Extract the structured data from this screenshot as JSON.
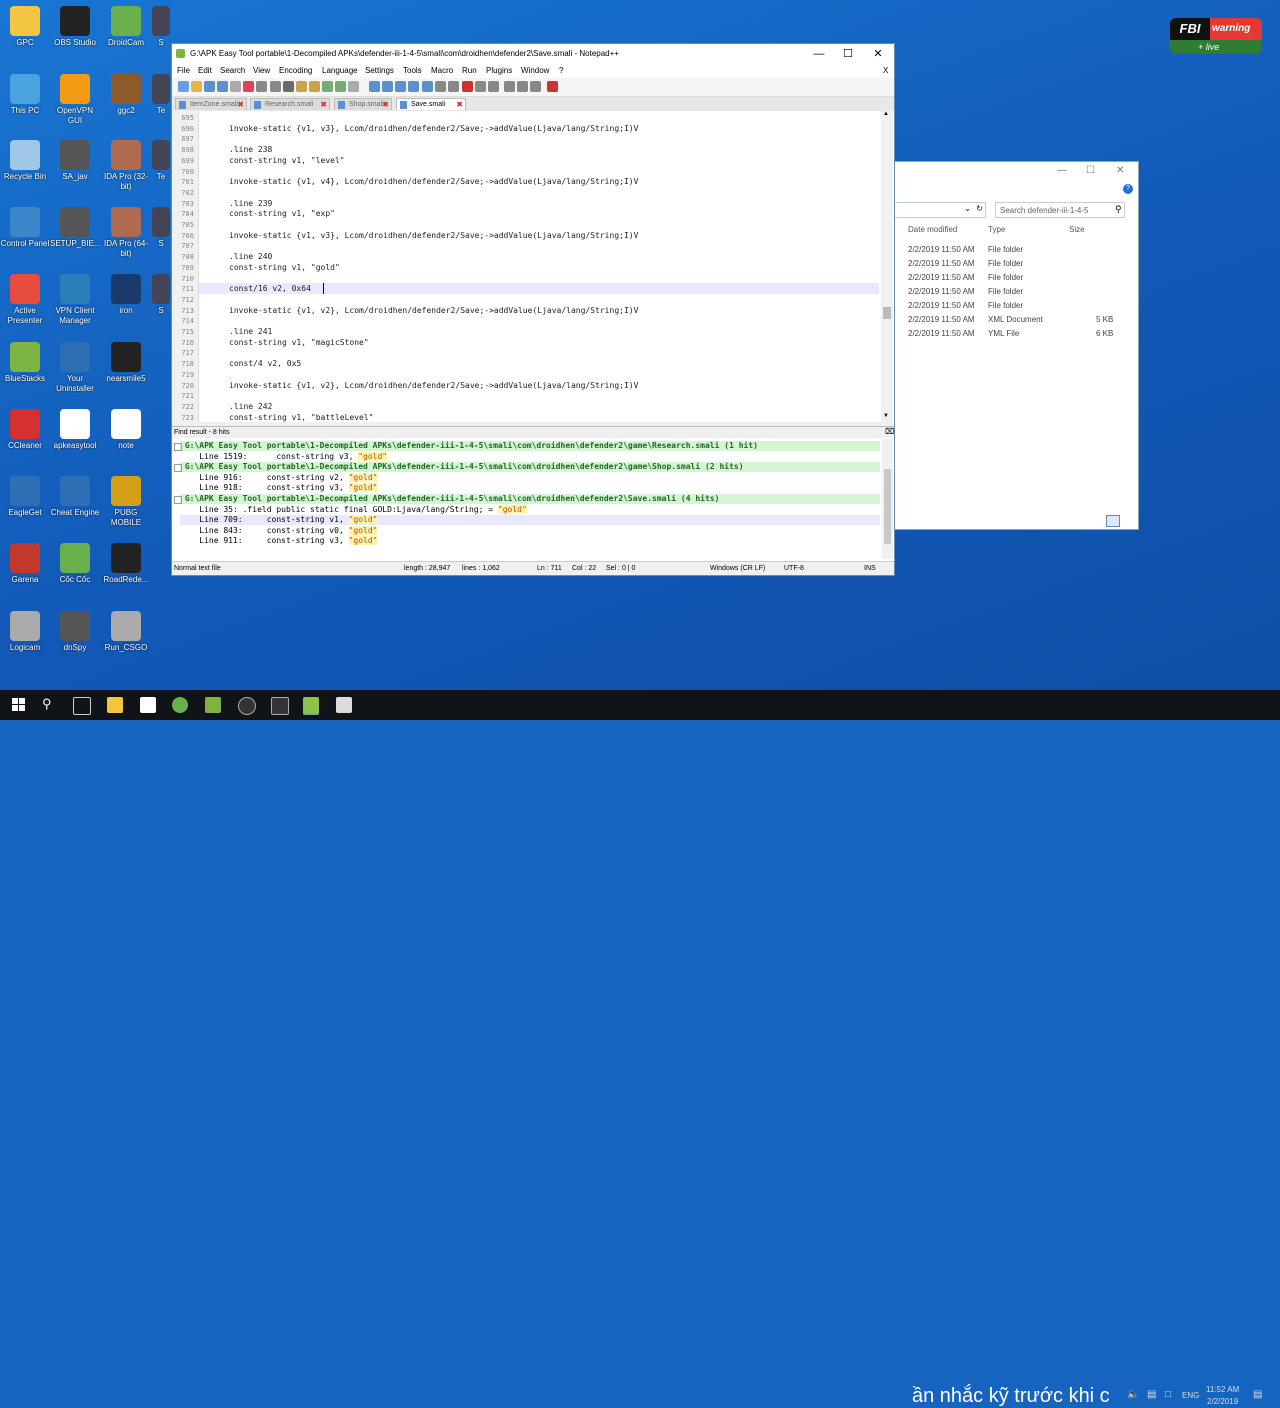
{
  "desktop_icons": [
    {
      "label": "GPC",
      "color": "#f4c542"
    },
    {
      "label": "OBS Studio",
      "color": "#222"
    },
    {
      "label": "DroidCam",
      "color": "#6ab04c"
    },
    {
      "label": "This PC",
      "color": "#4aa3df"
    },
    {
      "label": "OpenVPN GUI",
      "color": "#f39c12"
    },
    {
      "label": "ggc2",
      "color": "#8e5a2a"
    },
    {
      "label": "Recycle Bin",
      "color": "#9fc7e8"
    },
    {
      "label": "SA_jav",
      "color": "#555"
    },
    {
      "label": "IDA Pro (32-bit)",
      "color": "#b06a50"
    },
    {
      "label": "Control Panel",
      "color": "#3a86c8"
    },
    {
      "label": "SETUP_BIE...",
      "color": "#555"
    },
    {
      "label": "IDA Pro (64-bit)",
      "color": "#b06a50"
    },
    {
      "label": "Active Presenter",
      "color": "#e74c3c"
    },
    {
      "label": "VPN Client Manager",
      "color": "#2980b9"
    },
    {
      "label": "iron",
      "color": "#1a3a6a"
    },
    {
      "label": "BlueStacks",
      "color": "#7cb342"
    },
    {
      "label": "Your Uninstaller",
      "color": "#2c6fb5"
    },
    {
      "label": "nearsmile5",
      "color": "#222"
    },
    {
      "label": "CCleaner",
      "color": "#d63031"
    },
    {
      "label": "apkeasytool",
      "color": "#fff"
    },
    {
      "label": "note",
      "color": "#fff"
    },
    {
      "label": "EagleGet",
      "color": "#2c6fb5"
    },
    {
      "label": "Cheat Engine",
      "color": "#2c6fb5"
    },
    {
      "label": "PUBG MOBILE",
      "color": "#d4a017"
    },
    {
      "label": "Garena",
      "color": "#c0392b"
    },
    {
      "label": "Cốc Cốc",
      "color": "#6ab04c"
    },
    {
      "label": "RoadRede...",
      "color": "#222"
    },
    {
      "label": "Logicam",
      "color": "#aaa"
    },
    {
      "label": "dnSpy",
      "color": "#555"
    },
    {
      "label": "Run_CSGO",
      "color": "#aaa"
    }
  ],
  "partial_icons": [
    "S",
    "Te",
    "Te",
    "S",
    "S"
  ],
  "fbi_badge": {
    "fbi": "FBI",
    "warning": "warning",
    "live": "+ live"
  },
  "explorer": {
    "search_placeholder": "Search defender-iii-1-4-5",
    "col_date": "Date modified",
    "col_type": "Type",
    "col_size": "Size",
    "rows": [
      {
        "date": "2/2/2019 11:50 AM",
        "type": "File folder",
        "size": ""
      },
      {
        "date": "2/2/2019 11:50 AM",
        "type": "File folder",
        "size": ""
      },
      {
        "date": "2/2/2019 11:50 AM",
        "type": "File folder",
        "size": ""
      },
      {
        "date": "2/2/2019 11:50 AM",
        "type": "File folder",
        "size": ""
      },
      {
        "date": "2/2/2019 11:50 AM",
        "type": "File folder",
        "size": ""
      },
      {
        "date": "2/2/2019 11:50 AM",
        "type": "XML Document",
        "size": "5 KB"
      },
      {
        "date": "2/2/2019 11:50 AM",
        "type": "YML File",
        "size": "6 KB"
      }
    ]
  },
  "notepad": {
    "title": "G:\\APK Easy Tool portable\\1-Decompiled APKs\\defender-iii-1-4-5\\smali\\com\\droidhen\\defender2\\Save.smali - Notepad++",
    "menu": [
      "File",
      "Edit",
      "Search",
      "View",
      "Encoding",
      "Language",
      "Settings",
      "Tools",
      "Macro",
      "Run",
      "Plugins",
      "Window",
      "?"
    ],
    "close_x": "X",
    "tabs": [
      {
        "label": "ItemZone.smali",
        "active": false
      },
      {
        "label": "Research.smali",
        "active": false
      },
      {
        "label": "Shop.smali",
        "active": false
      },
      {
        "label": "Save.smali",
        "active": true
      }
    ],
    "lines": [
      {
        "n": "695",
        "code": ""
      },
      {
        "n": "696",
        "code": "invoke-static {v1, v3}, Lcom/droidhen/defender2/Save;->addValue(Ljava/lang/String;I)V"
      },
      {
        "n": "697",
        "code": ""
      },
      {
        "n": "698",
        "code": ".line 238"
      },
      {
        "n": "699",
        "code": "const-string v1, \"level\""
      },
      {
        "n": "700",
        "code": ""
      },
      {
        "n": "701",
        "code": "invoke-static {v1, v4}, Lcom/droidhen/defender2/Save;->addValue(Ljava/lang/String;I)V"
      },
      {
        "n": "702",
        "code": ""
      },
      {
        "n": "703",
        "code": ".line 239"
      },
      {
        "n": "704",
        "code": "const-string v1, \"exp\""
      },
      {
        "n": "705",
        "code": ""
      },
      {
        "n": "706",
        "code": "invoke-static {v1, v3}, Lcom/droidhen/defender2/Save;->addValue(Ljava/lang/String;I)V"
      },
      {
        "n": "707",
        "code": ""
      },
      {
        "n": "708",
        "code": ".line 240"
      },
      {
        "n": "709",
        "code": "const-string v1, \"gold\""
      },
      {
        "n": "710",
        "code": ""
      },
      {
        "n": "711",
        "code": "const/16 v2, 0x64"
      },
      {
        "n": "712",
        "code": ""
      },
      {
        "n": "713",
        "code": "invoke-static {v1, v2}, Lcom/droidhen/defender2/Save;->addValue(Ljava/lang/String;I)V"
      },
      {
        "n": "714",
        "code": ""
      },
      {
        "n": "715",
        "code": ".line 241"
      },
      {
        "n": "716",
        "code": "const-string v1, \"magicStone\""
      },
      {
        "n": "717",
        "code": ""
      },
      {
        "n": "718",
        "code": "const/4 v2, 0x5"
      },
      {
        "n": "719",
        "code": ""
      },
      {
        "n": "720",
        "code": "invoke-static {v1, v2}, Lcom/droidhen/defender2/Save;->addValue(Ljava/lang/String;I)V"
      },
      {
        "n": "721",
        "code": ""
      },
      {
        "n": "722",
        "code": ".line 242"
      },
      {
        "n": "723",
        "code": "const-string v1, \"battleLevel\""
      }
    ],
    "find_header": "Find result - 8 hits",
    "find_rows": [
      {
        "kind": "file",
        "pre": "G:\\APK Easy Tool portable\\1-Decompiled APKs\\defender-iii-1-4-5\\smali\\com\\droidhen\\defender2\\game\\Research.smali (1 hit)",
        "hit": "",
        "post": ""
      },
      {
        "kind": "hit",
        "pre": "    Line 1519:      const-string v3, ",
        "hit": "\"gold\"",
        "post": ""
      },
      {
        "kind": "file",
        "pre": "G:\\APK Easy Tool portable\\1-Decompiled APKs\\defender-iii-1-4-5\\smali\\com\\droidhen\\defender2\\game\\Shop.smali (2 hits)",
        "hit": "",
        "post": ""
      },
      {
        "kind": "hit",
        "pre": "    Line 916:     const-string v2, ",
        "hit": "\"gold\"",
        "post": ""
      },
      {
        "kind": "hit",
        "pre": "    Line 918:     const-string v3, ",
        "hit": "\"gold\"",
        "post": ""
      },
      {
        "kind": "file",
        "pre": "G:\\APK Easy Tool portable\\1-Decompiled APKs\\defender-iii-1-4-5\\smali\\com\\droidhen\\defender2\\Save.smali (4 hits)",
        "hit": "",
        "post": ""
      },
      {
        "kind": "hit",
        "pre": "    Line 35: .field public static final GOLD:Ljava/lang/String; = ",
        "hit": "\"gold\"",
        "post": ""
      },
      {
        "kind": "hit",
        "pre": "    Line 709:     const-string v1, ",
        "hit": "\"gold\"",
        "post": ""
      },
      {
        "kind": "hit",
        "pre": "    Line 843:     const-string v0, ",
        "hit": "\"gold\"",
        "post": ""
      },
      {
        "kind": "hit",
        "pre": "    Line 911:     const-string v3, ",
        "hit": "\"gold\"",
        "post": ""
      }
    ],
    "status": {
      "type": "Normal text file",
      "length": "length : 28,947",
      "lines": "lines : 1,062",
      "ln": "Ln : 711",
      "col": "Col : 22",
      "sel": "Sel : 0 | 0",
      "eol": "Windows (CR LF)",
      "enc": "UTF-8",
      "ins": "INS"
    }
  },
  "taskbar": {
    "subtitle": "ần nhắc kỹ trước khi c",
    "lang": "ENG",
    "time": "11:52 AM",
    "date": "2/2/2019"
  }
}
